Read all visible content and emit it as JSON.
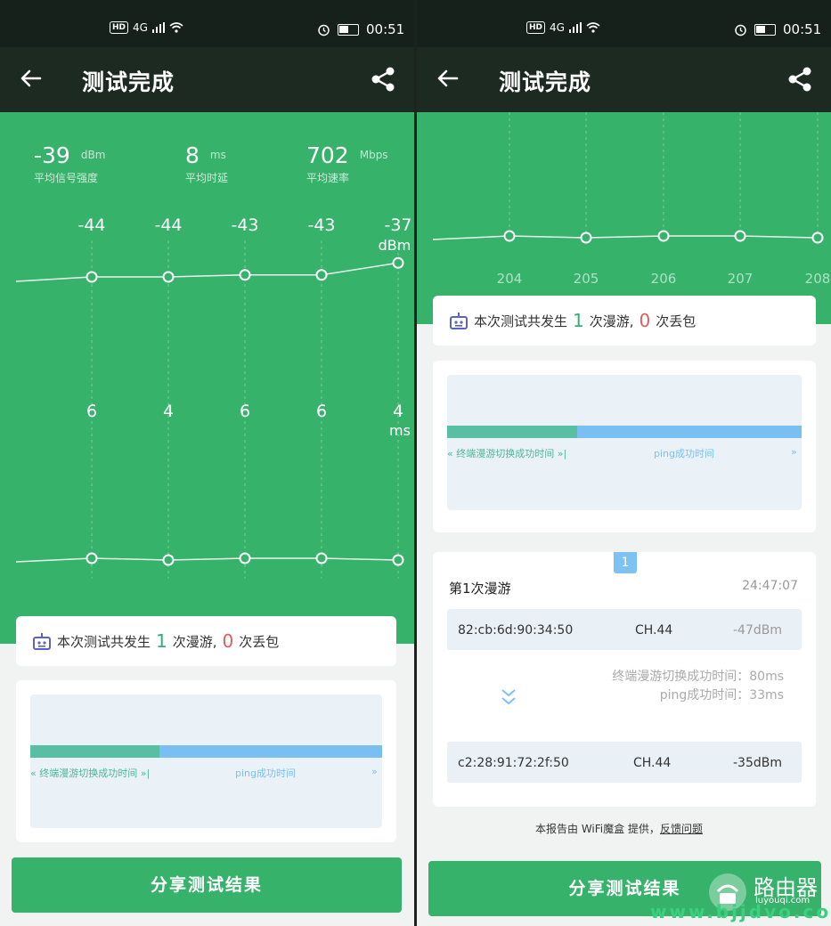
{
  "status_bar": {
    "network": "4G",
    "time": "00:51"
  },
  "app_bar": {
    "title": "测试完成"
  },
  "stats": [
    {
      "value": "-39",
      "unit": "dBm",
      "label": "平均信号强度"
    },
    {
      "value": "8",
      "unit": "ms",
      "label": "平均时延"
    },
    {
      "value": "702",
      "unit": "Mbps",
      "label": "平均速率"
    }
  ],
  "chart_data": [
    {
      "type": "line",
      "x": [
        "204",
        "205",
        "206",
        "207",
        "208"
      ],
      "series": [
        {
          "values": [
            -44,
            -44,
            -43,
            -43,
            -37
          ]
        }
      ],
      "unit": "dBm",
      "value_labels": [
        "-44",
        "-44",
        "-43",
        "-43",
        "-37"
      ]
    },
    {
      "type": "line",
      "x": [
        "204",
        "205",
        "206",
        "207",
        "208"
      ],
      "series": [
        {
          "values": [
            6,
            4,
            6,
            6,
            4
          ]
        }
      ],
      "unit": "ms",
      "value_labels": [
        "6",
        "4",
        "6",
        "6",
        "4"
      ]
    }
  ],
  "roam_summary": {
    "prefix": "本次测试共发生",
    "roams": "1",
    "roams_suffix": "次漫游,",
    "loss": "0",
    "loss_suffix": "次丢包"
  },
  "timeline": {
    "label_switch": "终端漫游切换成功时间",
    "label_ping": "ping成功时间"
  },
  "share_button": "分享测试结果",
  "roam_detail": {
    "badge": "1",
    "title": "第1次漫游",
    "time": "24:47:07",
    "from": {
      "mac": "82:cb:6d:90:34:50",
      "channel": "CH.44",
      "signal": "-47dBm"
    },
    "switch_time": "终端漫游切换成功时间：80ms",
    "ping_time": "ping成功时间：33ms",
    "to": {
      "mac": "c2:28:91:72:2f:50",
      "channel": "CH.44",
      "signal": "-35dBm"
    }
  },
  "footer": {
    "text": "本报告由 WiFi魔盒 提供，",
    "link": "反馈问题"
  },
  "watermark": {
    "brand": "路由器",
    "site": "luyouqi.com",
    "url": "www.bjjdvo.com"
  }
}
